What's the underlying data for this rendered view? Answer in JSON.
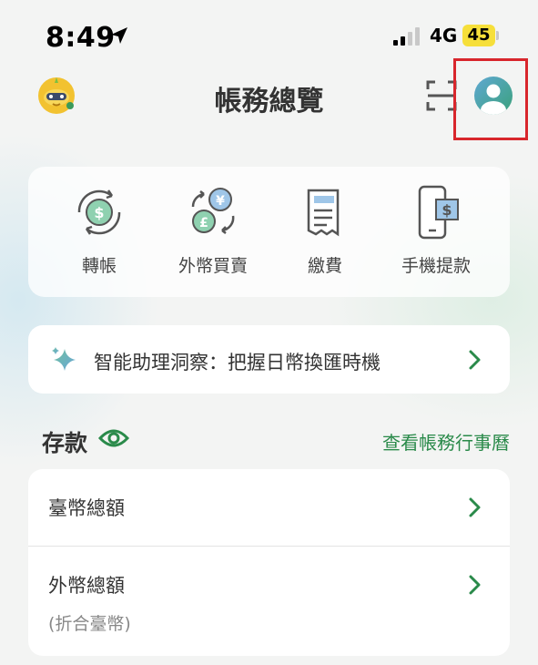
{
  "status_bar": {
    "time": "8:49",
    "network": "4G",
    "battery": "45"
  },
  "header": {
    "title": "帳務總覽"
  },
  "quick_actions": [
    {
      "label": "轉帳",
      "icon": "transfer-icon"
    },
    {
      "label": "外幣買賣",
      "icon": "currency-exchange-icon"
    },
    {
      "label": "繳費",
      "icon": "bill-icon"
    },
    {
      "label": "手機提款",
      "icon": "mobile-withdraw-icon"
    }
  ],
  "insight": {
    "text": "智能助理洞察：把握日幣換匯時機"
  },
  "deposit": {
    "title": "存款",
    "link": "查看帳務行事曆",
    "rows": [
      {
        "label": "臺幣總額"
      },
      {
        "label": "外幣總額",
        "sub": "(折合臺幣)"
      }
    ]
  },
  "colors": {
    "accent_green": "#2a8a4a",
    "highlight_red": "#d8262c"
  }
}
